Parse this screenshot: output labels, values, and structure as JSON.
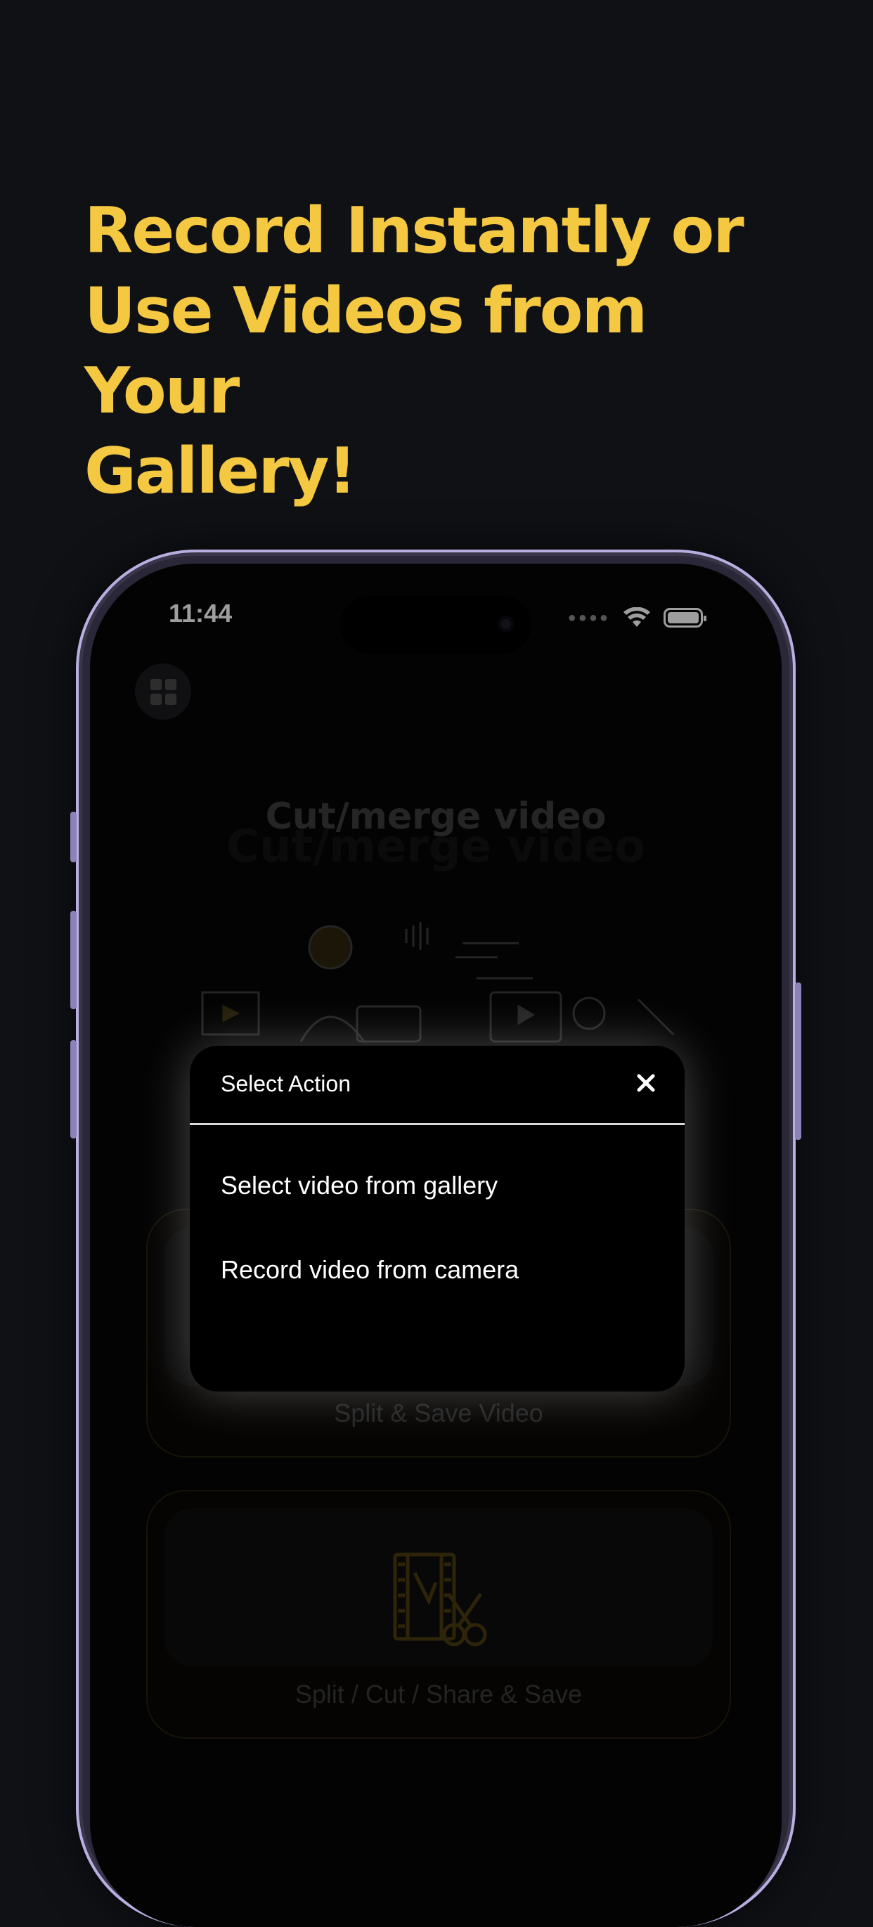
{
  "headline": {
    "lines": [
      "Record Instantly or",
      "Use Videos from Your",
      "Gallery!"
    ]
  },
  "status_bar": {
    "time": "11:44"
  },
  "app": {
    "title": "Cut/merge video",
    "menu_icon": "grid-icon",
    "cards": [
      {
        "label": "Split & Save Video",
        "icon": "video-icon"
      },
      {
        "label": "Split / Cut / Share & Save",
        "icon": "film-scissors-icon"
      }
    ]
  },
  "modal": {
    "title": "Select Action",
    "close_icon": "close-icon",
    "options": [
      "Select video from gallery",
      "Record video from camera"
    ]
  },
  "colors": {
    "accent": "#f5c842",
    "background": "#0f1115",
    "phone_frame": "#b8aee0"
  }
}
